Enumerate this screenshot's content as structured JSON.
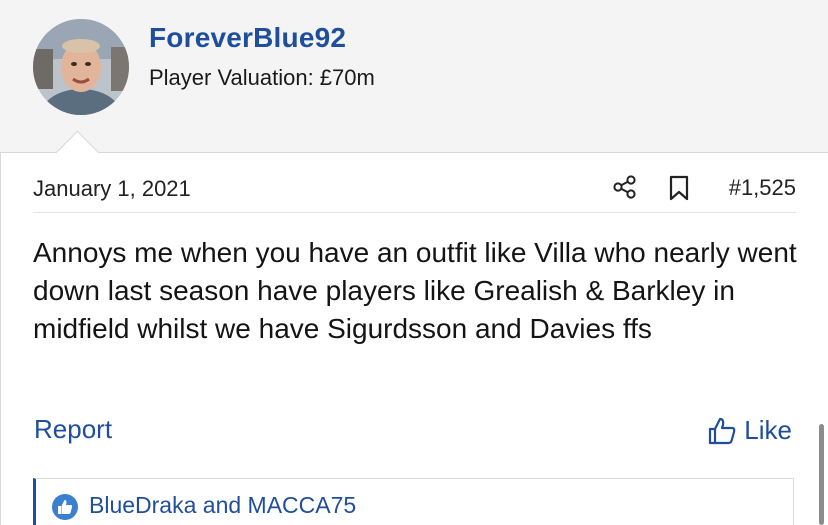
{
  "user": {
    "username": "ForeverBlue92",
    "valuation": "Player Valuation: £70m"
  },
  "post": {
    "date": "January 1, 2021",
    "number": "#1,525",
    "message": "Annoys me when you have an outfit like Villa who nearly went down last season have players like Grealish & Barkley in midfield whilst we have Sigurdsson and Davies ffs"
  },
  "actions": {
    "report": "Report",
    "like": "Like"
  },
  "reactions": {
    "text": "BlueDraka and MACCA75"
  },
  "icons": {
    "share": "share-icon",
    "bookmark": "bookmark-icon",
    "like": "thumbs-up-icon",
    "reaction": "like-reaction-icon"
  },
  "colors": {
    "accent": "#1f4e9c",
    "header_bg": "#f4f4f4",
    "text": "#141414"
  }
}
